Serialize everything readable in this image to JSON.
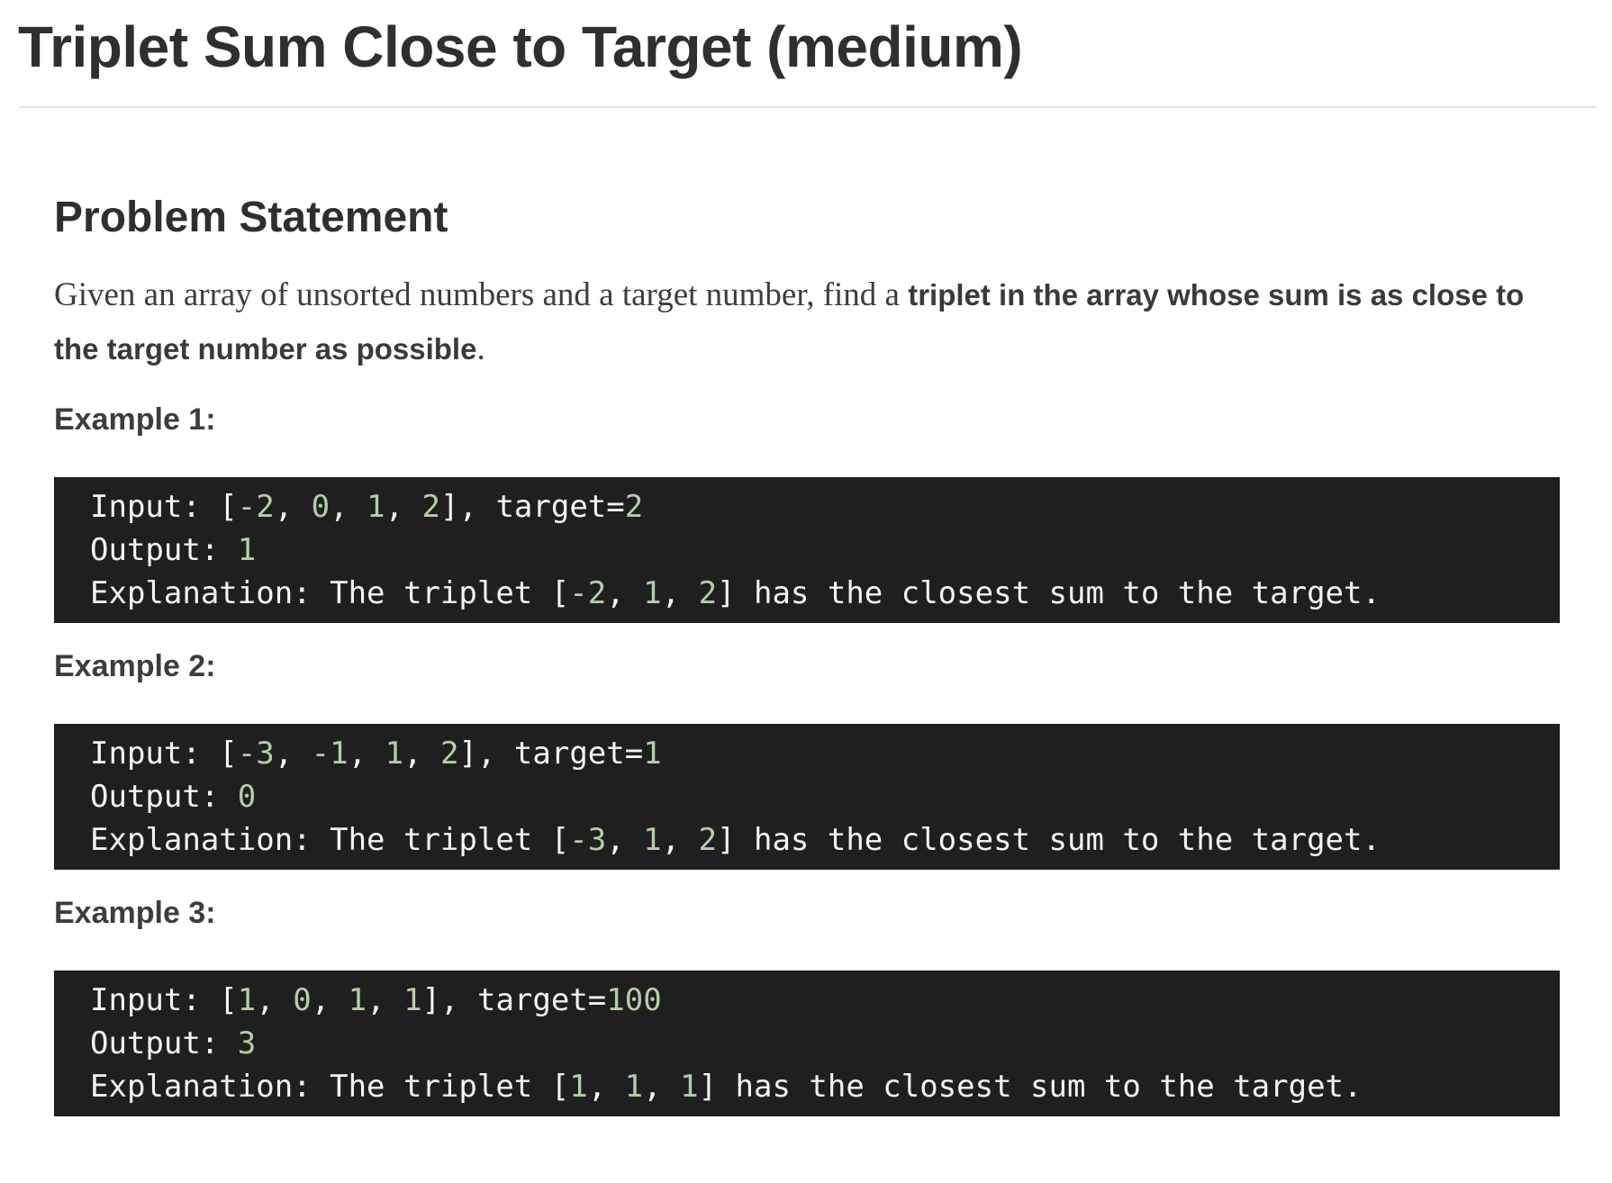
{
  "page": {
    "title": "Triplet Sum Close to Target (medium)"
  },
  "problem": {
    "heading": "Problem Statement",
    "description_plain": "Given an array of unsorted numbers and a target number, find a ",
    "description_bold": "triplet in the array whose sum is as close to the target number as possible",
    "description_end": "."
  },
  "examples": [
    {
      "heading": "Example 1:",
      "lines": [
        [
          {
            "t": "Input: [",
            "n": false
          },
          {
            "t": "-2",
            "n": true
          },
          {
            "t": ", ",
            "n": false
          },
          {
            "t": "0",
            "n": true
          },
          {
            "t": ", ",
            "n": false
          },
          {
            "t": "1",
            "n": true
          },
          {
            "t": ", ",
            "n": false
          },
          {
            "t": "2",
            "n": true
          },
          {
            "t": "], target=",
            "n": false
          },
          {
            "t": "2",
            "n": true
          }
        ],
        [
          {
            "t": "Output: ",
            "n": false
          },
          {
            "t": "1",
            "n": true
          }
        ],
        [
          {
            "t": "Explanation: The triplet [",
            "n": false
          },
          {
            "t": "-2",
            "n": true
          },
          {
            "t": ", ",
            "n": false
          },
          {
            "t": "1",
            "n": true
          },
          {
            "t": ", ",
            "n": false
          },
          {
            "t": "2",
            "n": true
          },
          {
            "t": "] has the closest sum to the target.",
            "n": false
          }
        ]
      ]
    },
    {
      "heading": "Example 2:",
      "lines": [
        [
          {
            "t": "Input: [",
            "n": false
          },
          {
            "t": "-3",
            "n": true
          },
          {
            "t": ", ",
            "n": false
          },
          {
            "t": "-1",
            "n": true
          },
          {
            "t": ", ",
            "n": false
          },
          {
            "t": "1",
            "n": true
          },
          {
            "t": ", ",
            "n": false
          },
          {
            "t": "2",
            "n": true
          },
          {
            "t": "], target=",
            "n": false
          },
          {
            "t": "1",
            "n": true
          }
        ],
        [
          {
            "t": "Output: ",
            "n": false
          },
          {
            "t": "0",
            "n": true
          }
        ],
        [
          {
            "t": "Explanation: The triplet [",
            "n": false
          },
          {
            "t": "-3",
            "n": true
          },
          {
            "t": ", ",
            "n": false
          },
          {
            "t": "1",
            "n": true
          },
          {
            "t": ", ",
            "n": false
          },
          {
            "t": "2",
            "n": true
          },
          {
            "t": "] has the closest sum to the target.",
            "n": false
          }
        ]
      ]
    },
    {
      "heading": "Example 3:",
      "lines": [
        [
          {
            "t": "Input: [",
            "n": false
          },
          {
            "t": "1",
            "n": true
          },
          {
            "t": ", ",
            "n": false
          },
          {
            "t": "0",
            "n": true
          },
          {
            "t": ", ",
            "n": false
          },
          {
            "t": "1",
            "n": true
          },
          {
            "t": ", ",
            "n": false
          },
          {
            "t": "1",
            "n": true
          },
          {
            "t": "], target=",
            "n": false
          },
          {
            "t": "100",
            "n": true
          }
        ],
        [
          {
            "t": "Output: ",
            "n": false
          },
          {
            "t": "3",
            "n": true
          }
        ],
        [
          {
            "t": "Explanation: The triplet [",
            "n": false
          },
          {
            "t": "1",
            "n": true
          },
          {
            "t": ", ",
            "n": false
          },
          {
            "t": "1",
            "n": true
          },
          {
            "t": ", ",
            "n": false
          },
          {
            "t": "1",
            "n": true
          },
          {
            "t": "] has the closest sum to the target.",
            "n": false
          }
        ]
      ]
    }
  ],
  "colors": {
    "code_background": "#1f1f1f",
    "code_text": "#f4f4f4",
    "number_literal": "#b5cea8",
    "heading_text": "#2f2f2f"
  }
}
